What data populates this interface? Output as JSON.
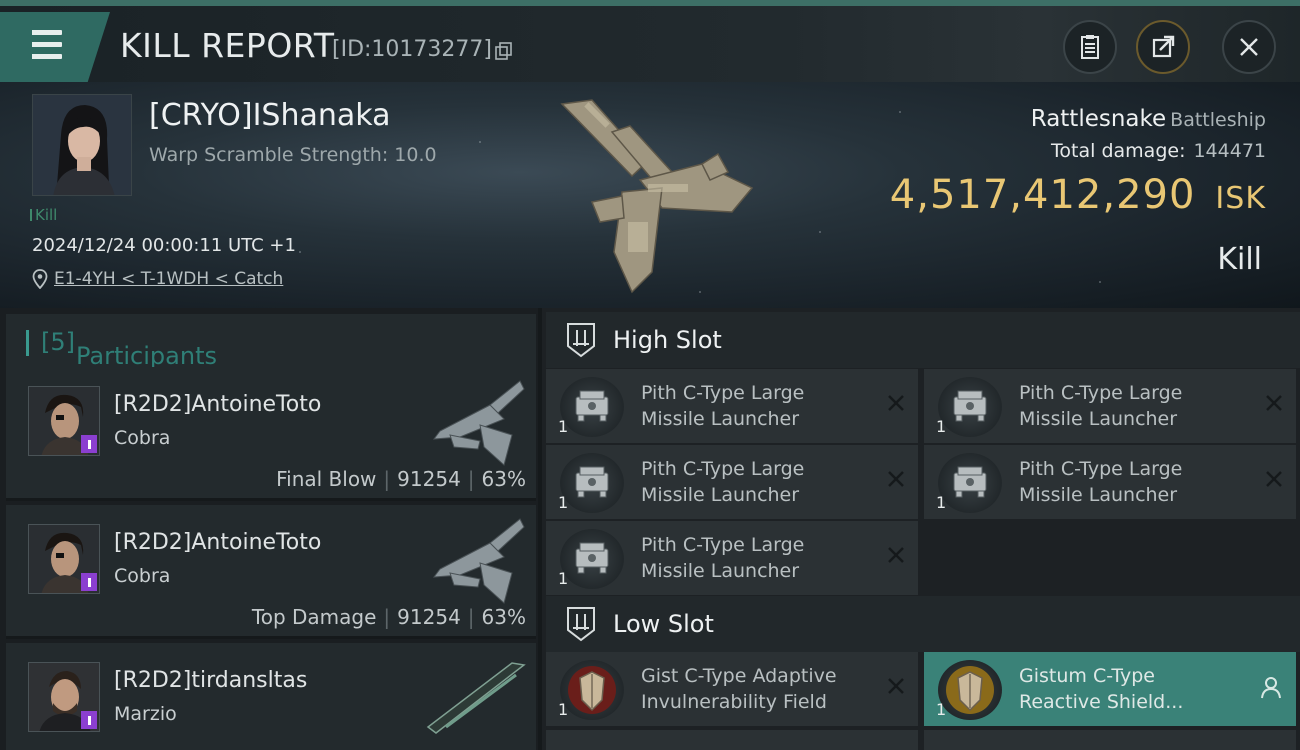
{
  "header": {
    "title": "KILL REPORT",
    "report_id": "[ID:10173277]"
  },
  "victim": {
    "name": "[CRYO]IShanaka",
    "warp_scramble": "Warp Scramble Strength: 10.0",
    "tag": "Kill",
    "timestamp": "2024/12/24 00:00:11 UTC +1",
    "location": "E1-4YH < T-1WDH < Catch",
    "ship_name": "Rattlesnake",
    "ship_class": "Battleship",
    "total_damage_label": "Total damage:",
    "total_damage_value": "144471",
    "isk_value": "4,517,412,290",
    "isk_unit": "ISK",
    "result": "Kill"
  },
  "participants": {
    "label": "Participants",
    "count": "[5]",
    "items": [
      {
        "name": "[R2D2]AntoineToto",
        "ship": "Cobra",
        "role": "Final Blow",
        "damage": "91254",
        "percent": "63%"
      },
      {
        "name": "[R2D2]AntoineToto",
        "ship": "Cobra",
        "role": "Top Damage",
        "damage": "91254",
        "percent": "63%"
      },
      {
        "name": "[R2D2]tirdansltas",
        "ship": "Marzio",
        "role": "",
        "damage": "",
        "percent": ""
      }
    ]
  },
  "fitting": {
    "high_slot": {
      "label": "High Slot",
      "modules": [
        {
          "line1": "Pith C-Type Large",
          "line2": "Missile Launcher",
          "qty": "1"
        },
        {
          "line1": "Pith C-Type Large",
          "line2": "Missile Launcher",
          "qty": "1"
        },
        {
          "line1": "Pith C-Type Large",
          "line2": "Missile Launcher",
          "qty": "1"
        },
        {
          "line1": "Pith C-Type Large",
          "line2": "Missile Launcher",
          "qty": "1"
        },
        {
          "line1": "Pith C-Type Large",
          "line2": "Missile Launcher",
          "qty": "1"
        }
      ]
    },
    "low_slot": {
      "label": "Low Slot",
      "modules": [
        {
          "line1": "Gist C-Type Adaptive",
          "line2": "Invulnerability Field",
          "qty": "1"
        },
        {
          "line1": "Gistum C-Type",
          "line2": "Reactive Shield...",
          "qty": "1"
        }
      ]
    }
  },
  "colors": {
    "accent": "#3a8278",
    "isk_gold": "#e9c774",
    "tab_green": "#2f6a62",
    "badge_purple": "#8b3fd0"
  }
}
